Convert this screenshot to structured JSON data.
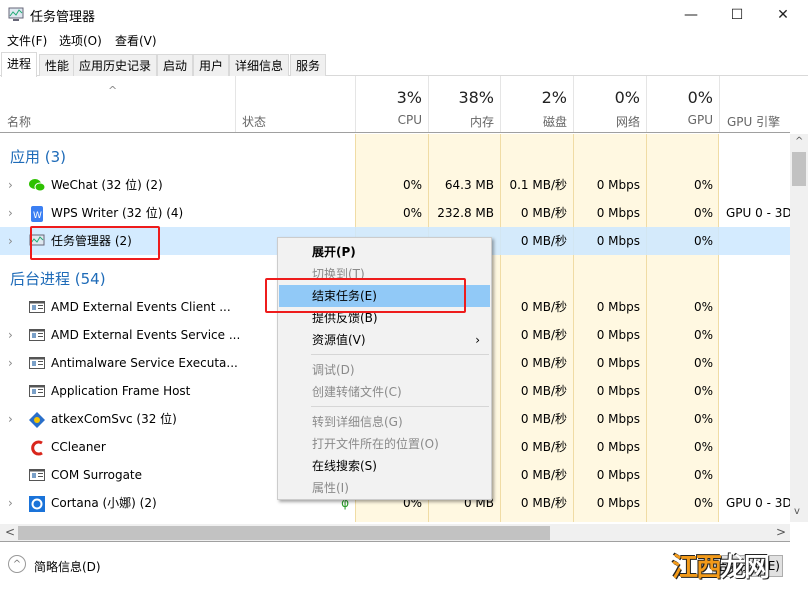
{
  "window": {
    "title": "任务管理器",
    "minimize": "—",
    "maximize": "☐",
    "close": "✕"
  },
  "menubar": [
    "文件(F)",
    "选项(O)",
    "查看(V)"
  ],
  "tabs": [
    "进程",
    "性能",
    "应用历史记录",
    "启动",
    "用户",
    "详细信息",
    "服务"
  ],
  "columns": {
    "name": "名称",
    "status": "状态",
    "cpu": {
      "pct": "3%",
      "label": "CPU"
    },
    "mem": {
      "pct": "38%",
      "label": "内存"
    },
    "disk": {
      "pct": "2%",
      "label": "磁盘"
    },
    "net": {
      "pct": "0%",
      "label": "网络"
    },
    "gpu": {
      "pct": "0%",
      "label": "GPU"
    },
    "gpuengine": "GPU 引擎"
  },
  "groups": {
    "apps": "应用 (3)",
    "background": "后台进程 (54)"
  },
  "apps": [
    {
      "name": "WeChat (32 位) (2)",
      "icon": "wechat-icon",
      "expand": true,
      "cpu": "0%",
      "mem": "64.3 MB",
      "disk": "0.1 MB/秒",
      "net": "0 Mbps",
      "gpu": "0%",
      "engine": ""
    },
    {
      "name": "WPS Writer (32 位) (4)",
      "icon": "wps-icon",
      "expand": true,
      "cpu": "0%",
      "mem": "232.8 MB",
      "disk": "0 MB/秒",
      "net": "0 Mbps",
      "gpu": "0%",
      "engine": "GPU 0 - 3D"
    },
    {
      "name": "任务管理器 (2)",
      "icon": "taskmgr-icon",
      "expand": true,
      "selected": true,
      "cpu": "",
      "mem": "",
      "disk": "0 MB/秒",
      "net": "0 Mbps",
      "gpu": "0%",
      "engine": ""
    }
  ],
  "background": [
    {
      "name": "AMD External Events Client ...",
      "icon": "window-icon",
      "expand": false,
      "cpu": "",
      "mem": "",
      "disk": "0 MB/秒",
      "net": "0 Mbps",
      "gpu": "0%",
      "engine": ""
    },
    {
      "name": "AMD External Events Service ...",
      "icon": "window-icon",
      "expand": true,
      "cpu": "",
      "mem": "",
      "disk": "0 MB/秒",
      "net": "0 Mbps",
      "gpu": "0%",
      "engine": ""
    },
    {
      "name": "Antimalware Service Executa...",
      "icon": "window-icon",
      "expand": true,
      "cpu": "",
      "mem": "",
      "disk": "0 MB/秒",
      "net": "0 Mbps",
      "gpu": "0%",
      "engine": ""
    },
    {
      "name": "Application Frame Host",
      "icon": "window-icon",
      "expand": false,
      "cpu": "",
      "mem": "",
      "disk": "0 MB/秒",
      "net": "0 Mbps",
      "gpu": "0%",
      "engine": ""
    },
    {
      "name": "atkexComSvc (32 位)",
      "icon": "atkex-icon",
      "expand": true,
      "cpu": "",
      "mem": "",
      "disk": "0 MB/秒",
      "net": "0 Mbps",
      "gpu": "0%",
      "engine": ""
    },
    {
      "name": "CCleaner",
      "icon": "ccleaner-icon",
      "expand": false,
      "cpu": "",
      "mem": "",
      "disk": "0 MB/秒",
      "net": "0 Mbps",
      "gpu": "0%",
      "engine": ""
    },
    {
      "name": "COM Surrogate",
      "icon": "window-icon",
      "expand": false,
      "cpu": "",
      "mem": "",
      "disk": "0 MB/秒",
      "net": "0 Mbps",
      "gpu": "0%",
      "engine": ""
    },
    {
      "name": "Cortana (小娜) (2)",
      "icon": "cortana-icon",
      "expand": true,
      "status": "φ",
      "cpu": "0%",
      "mem": "0 MB",
      "disk": "0 MB/秒",
      "net": "0 Mbps",
      "gpu": "0%",
      "engine": "GPU 0 - 3D"
    }
  ],
  "context_menu": [
    {
      "label": "展开(P)",
      "bold": true,
      "enabled": true
    },
    {
      "label": "切换到(T)",
      "enabled": false
    },
    {
      "label": "结束任务(E)",
      "enabled": true,
      "highlighted": true
    },
    {
      "label": "提供反馈(B)",
      "enabled": true
    },
    {
      "label": "资源值(V)",
      "enabled": true,
      "submenu": true
    },
    {
      "sep": true
    },
    {
      "label": "调试(D)",
      "enabled": false
    },
    {
      "label": "创建转储文件(C)",
      "enabled": false
    },
    {
      "sep": true
    },
    {
      "label": "转到详细信息(G)",
      "enabled": false
    },
    {
      "label": "打开文件所在的位置(O)",
      "enabled": false
    },
    {
      "label": "在线搜索(S)",
      "enabled": true
    },
    {
      "label": "属性(I)",
      "enabled": false
    }
  ],
  "footer": {
    "less_details": "简略信息(D)",
    "end_task": "结束任务(E)"
  },
  "watermark": "江西龙网",
  "colors": {
    "highlight_row": "#cce8ff",
    "menu_highlight": "#91c9f7",
    "annotation": "#ee1c1c",
    "heat": "#fff4c4",
    "group": "#1e6bb8"
  }
}
